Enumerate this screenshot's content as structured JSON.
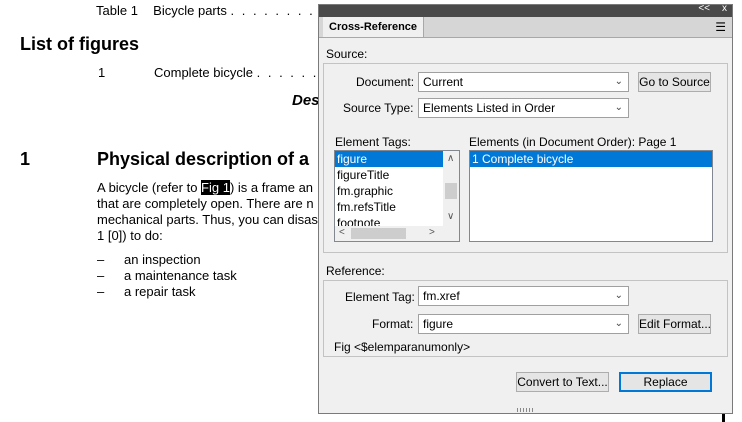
{
  "document": {
    "table_line": {
      "num": "Table 1",
      "title": "Bicycle parts",
      "dots": ". . . . . . . . . ."
    },
    "list_heading": "List of figures",
    "figure_line": {
      "num": "1",
      "title": "Complete bicycle",
      "dots": ". . . . . ."
    },
    "centered_fragment": "Des",
    "section": {
      "num": "1",
      "title": "Physical description of a"
    },
    "paragraph": {
      "line1_before": "A bicycle (refer to ",
      "xref": "Fig 1",
      "line1_after": ") is a frame an",
      "line2": "that are completely open. There are n",
      "line3": "mechanical parts. Thus, you can disas",
      "line4": "1 [0]) to do:"
    },
    "bullets": [
      {
        "dash": "–",
        "text": "an inspection"
      },
      {
        "dash": "–",
        "text": "a maintenance task"
      },
      {
        "dash": "–",
        "text": "a repair task"
      }
    ]
  },
  "dialog": {
    "top_controls": {
      "collapse": "<<",
      "close": "x"
    },
    "tab": "Cross-Reference",
    "menu_icon": "hamburger-menu-icon",
    "source_label": "Source:",
    "document_label": "Document:",
    "document_value": "Current",
    "go_to_source": "Go to Source",
    "source_type_label": "Source Type:",
    "source_type_value": "Elements Listed in Order",
    "element_tags_label": "Element Tags:",
    "element_tags": [
      "figure",
      "figureTitle",
      "fm.graphic",
      "fm.refsTitle",
      "footnote"
    ],
    "elements_label": "Elements (in Document Order): Page  1",
    "elements": [
      "1 Complete bicycle"
    ],
    "reference_label": "Reference:",
    "element_tag_label": "Element Tag:",
    "element_tag_value": "fm.xref",
    "format_label": "Format:",
    "format_value": "figure",
    "edit_format": "Edit Format...",
    "format_preview": "Fig <$elemparanumonly>",
    "convert_to_text": "Convert to Text...",
    "replace": "Replace"
  }
}
